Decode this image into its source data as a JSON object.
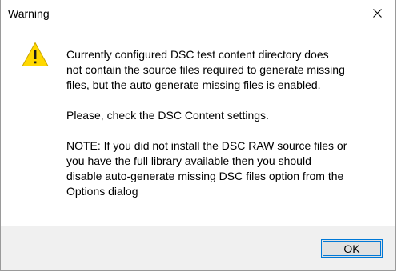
{
  "dialog": {
    "title": "Warning",
    "icon": "warning-icon",
    "close_icon": "close-icon",
    "colors": {
      "warning_fill": "#ffd800",
      "button_focus_border": "#0078d7",
      "footer_bg": "#f0f0f0"
    },
    "message": {
      "paragraph1": [
        "Currently configured DSC test content directory does",
        "not contain the source files required to generate missing",
        "files, but the auto generate missing files is enabled."
      ],
      "paragraph2": [
        "Please, check the DSC Content settings."
      ],
      "paragraph3": [
        "NOTE: If you did not install the DSC RAW source files or",
        "you have the full library available then you should",
        "disable auto-generate missing DSC files option from the",
        "Options dialog"
      ]
    },
    "buttons": {
      "ok_label": "OK"
    }
  }
}
